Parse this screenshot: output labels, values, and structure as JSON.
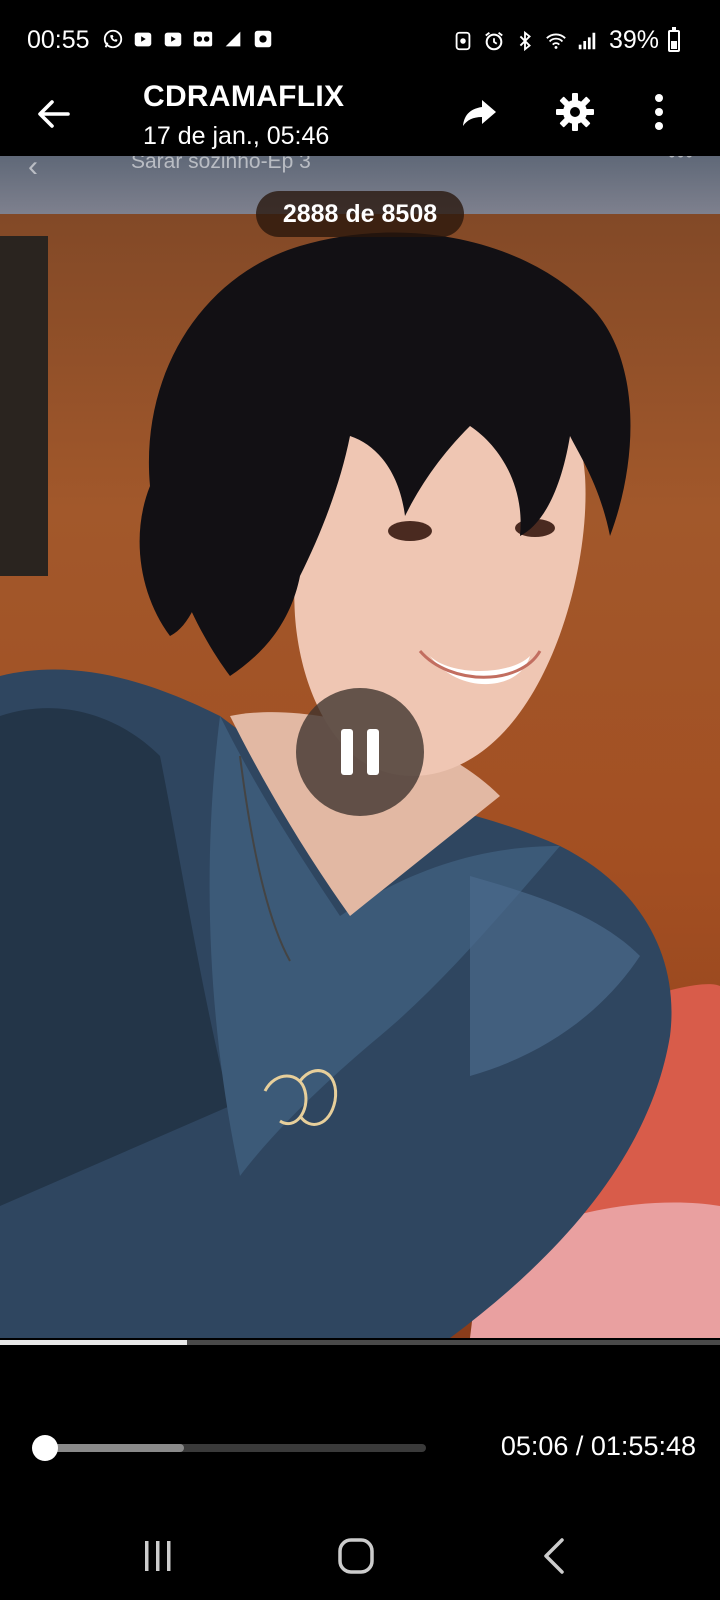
{
  "status_bar": {
    "time": "00:55",
    "notification_icons": [
      "whatsapp-icon",
      "video-icon",
      "video-icon",
      "voicemail-icon",
      "chart-icon",
      "media-icon"
    ],
    "system_icons": [
      "nfc-icon",
      "alarm-icon",
      "bluetooth-icon",
      "wifi-icon",
      "signal-icon"
    ],
    "battery": "39%"
  },
  "header": {
    "title": "CDRAMAFLIX",
    "subtitle": "17 de jan., 05:46"
  },
  "video": {
    "episode_title": "Sarar sozinho-Ep 3",
    "counter": "2888 de 8508",
    "progress": 0.26
  },
  "player": {
    "time": "05:06 / 01:55:48",
    "seek_position": 0.022,
    "buffered": 0.38
  },
  "colors": {
    "background": "#000000",
    "accent": "#ffffff"
  }
}
